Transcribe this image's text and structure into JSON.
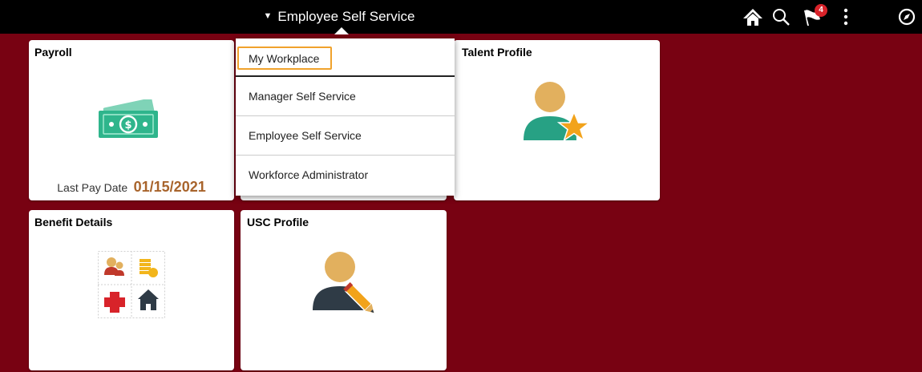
{
  "header": {
    "title": "Employee Self Service",
    "notification_count": "4",
    "icons": [
      "home-icon",
      "search-icon",
      "notifications-flag-icon",
      "actions-menu-icon",
      "navbar-compass-icon"
    ]
  },
  "nav_menu": {
    "items": [
      {
        "label": "My Workplace",
        "focused": true
      },
      {
        "label": "Manager Self Service"
      },
      {
        "label": "Employee Self Service"
      },
      {
        "label": "Workforce Administrator"
      }
    ]
  },
  "tiles": {
    "payroll": {
      "title": "Payroll",
      "last_pay_label": "Last Pay Date",
      "last_pay_value": "01/15/2021",
      "icon": "money-icon"
    },
    "talent_profile": {
      "title": "Talent Profile",
      "icon": "person-star-icon"
    },
    "benefit_details": {
      "title": "Benefit Details",
      "icon": "benefits-grid-icon"
    },
    "usc_profile": {
      "title": "USC Profile",
      "icon": "person-pencil-icon"
    }
  },
  "colors": {
    "background": "#780212",
    "topbar": "#000000",
    "focus_ring": "#f0a22c",
    "pay_date": "#a8642c",
    "badge": "#d8232a"
  }
}
